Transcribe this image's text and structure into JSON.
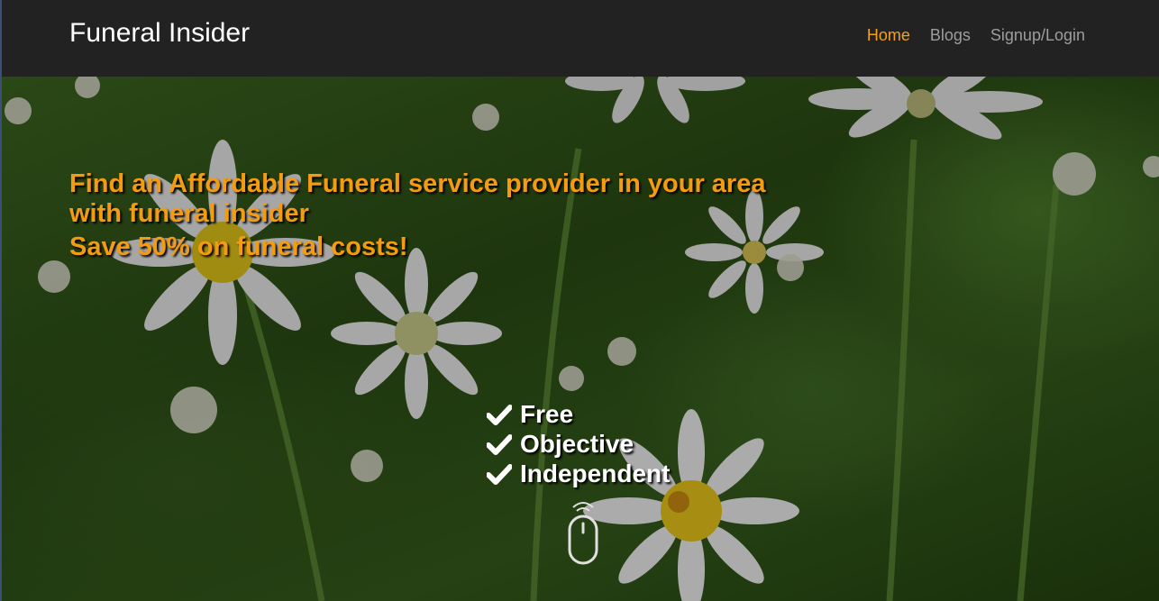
{
  "navbar": {
    "brand": "Funeral Insider",
    "links": [
      {
        "label": "Home",
        "active": true
      },
      {
        "label": "Blogs",
        "active": false
      },
      {
        "label": "Signup/Login",
        "active": false
      }
    ]
  },
  "hero": {
    "headline_line1": "Find an Affordable Funeral service provider in your area with funeral insider",
    "headline_line2": "Save 50% on funeral costs!",
    "features": [
      "Free",
      "Objective",
      "Independent"
    ],
    "icons": {
      "feature": "check-icon",
      "scroll": "scroll-mouse-icon"
    }
  },
  "colors": {
    "navbar_bg": "#222222",
    "accent": "#f0a11e",
    "headline": "#f39c12",
    "nav_link": "#9d9d9d"
  }
}
